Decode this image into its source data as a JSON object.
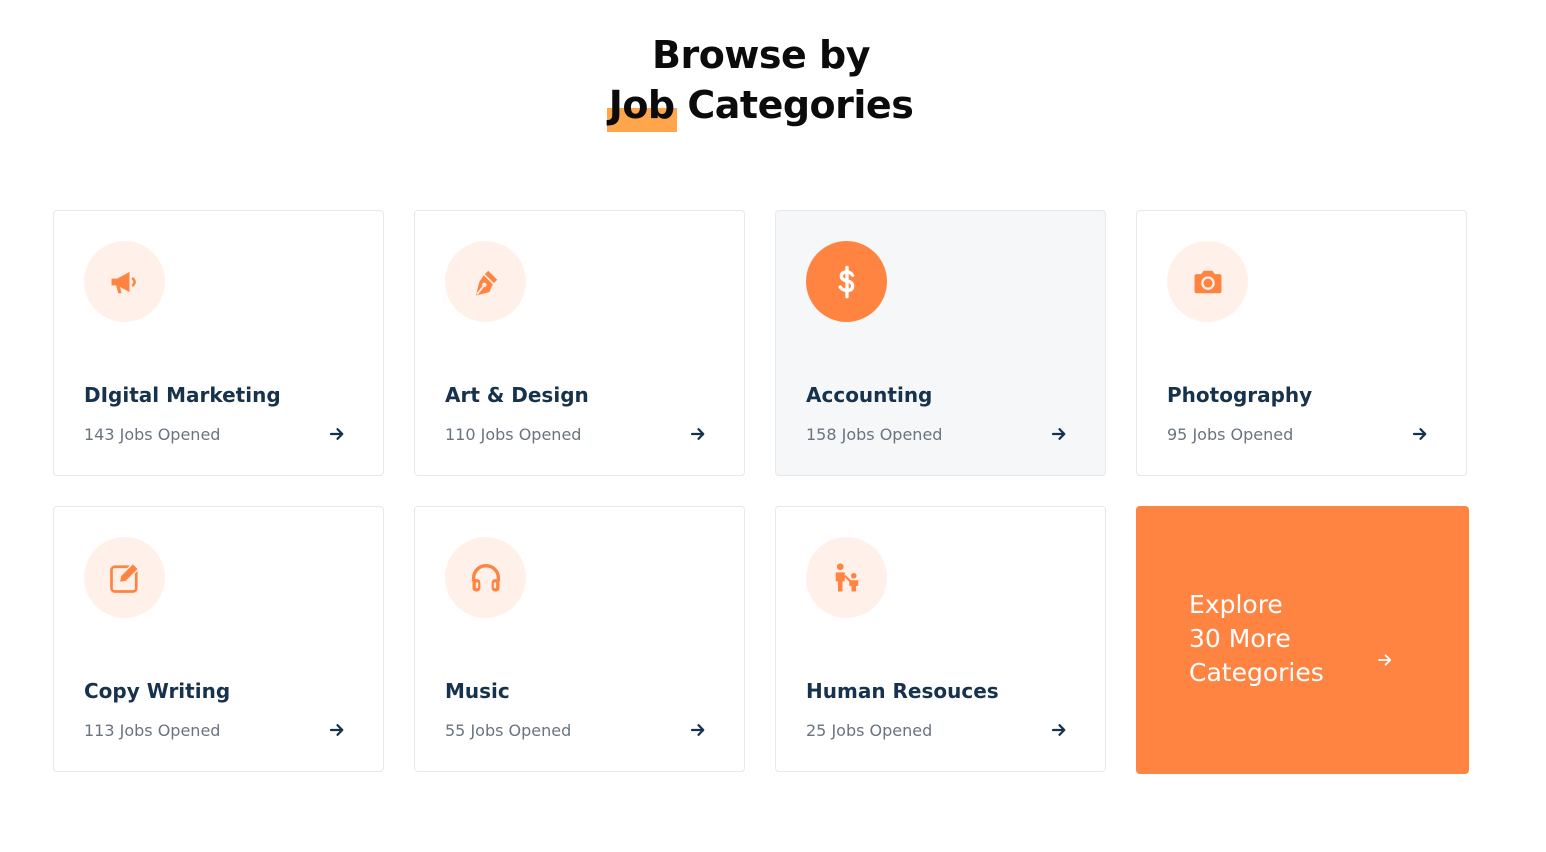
{
  "heading": {
    "line1": "Browse by",
    "line2_highlight": "Job",
    "line2_rest": "Categories"
  },
  "colors": {
    "accent": "#ff8442",
    "highlight": "#ffa64d",
    "icon_bg": "#fff1ea",
    "title": "#17324d",
    "muted": "#6a7480"
  },
  "categories": [
    {
      "title": "DIgital Marketing",
      "count": "143 Jobs Opened",
      "icon": "megaphone-icon"
    },
    {
      "title": "Art & Design",
      "count": "110 Jobs Opened",
      "icon": "pen-nib-icon"
    },
    {
      "title": "Accounting",
      "count": "158 Jobs Opened",
      "icon": "dollar-icon",
      "active": true
    },
    {
      "title": "Photography",
      "count": "95 Jobs Opened",
      "icon": "camera-icon"
    },
    {
      "title": "Copy Writing",
      "count": "113 Jobs Opened",
      "icon": "edit-icon"
    },
    {
      "title": "Music",
      "count": "55 Jobs Opened",
      "icon": "headphones-icon"
    },
    {
      "title": "Human Resouces",
      "count": "25 Jobs Opened",
      "icon": "parent-child-icon"
    }
  ],
  "explore": {
    "line1": "Explore",
    "line2": "30 More",
    "line3": "Categories"
  }
}
